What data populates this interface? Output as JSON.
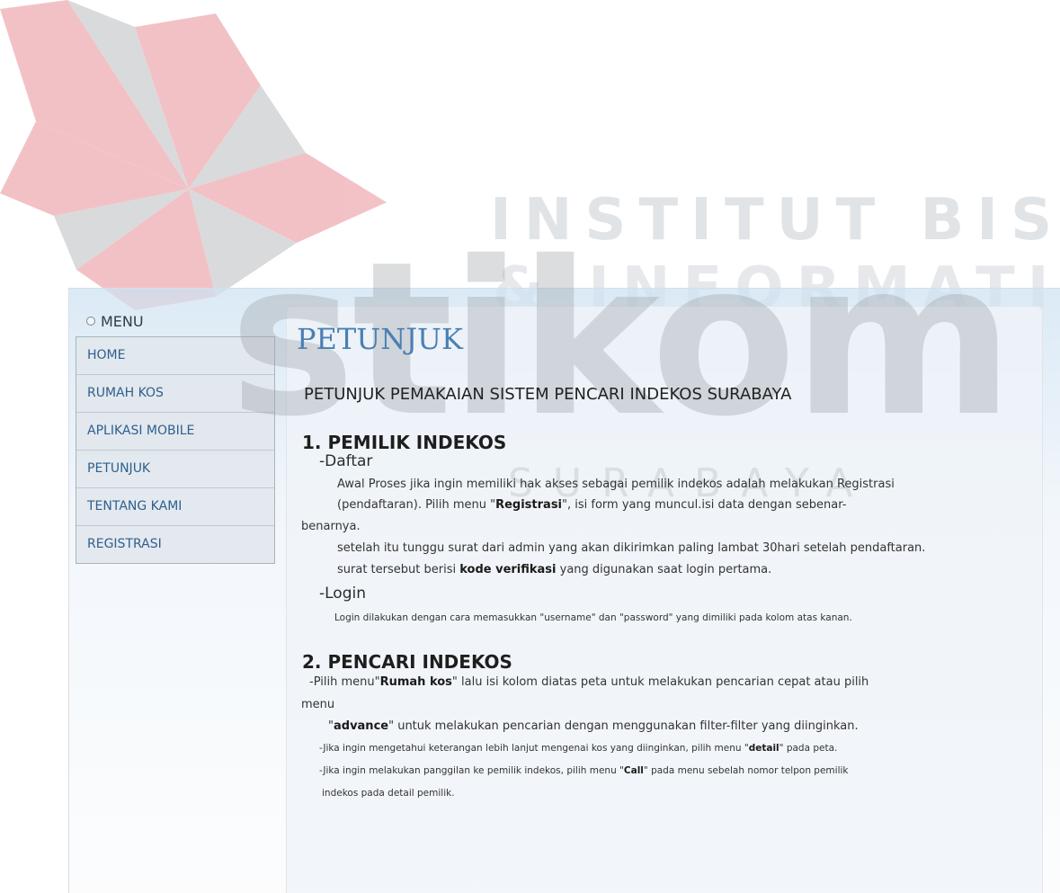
{
  "watermark": {
    "line1": "INSTITUT BISNIS",
    "line2": "& INFORMATIKA",
    "brand": "stikom",
    "line3": "SURABAYA",
    "logo_colors": [
      "#d94150",
      "#8a8f93"
    ]
  },
  "sidebar": {
    "title": "MENU",
    "items": [
      {
        "label": "HOME"
      },
      {
        "label": "RUMAH KOS"
      },
      {
        "label": "APLIKASI MOBILE"
      },
      {
        "label": "PETUNJUK"
      },
      {
        "label": "TENTANG KAMI"
      },
      {
        "label": "REGISTRASI"
      }
    ]
  },
  "main": {
    "title": "PETUNJUK",
    "subtitle": "PETUNJUK PEMAKAIAN SISTEM PENCARI INDEKOS SURABAYA",
    "section1": {
      "heading": "1. PEMILIK INDEKOS",
      "daftar_heading": "-Daftar",
      "daftar_line1": "Awal Proses jika ingin memiliki hak akses sebagai pemilik indekos adalah melakukan Registrasi",
      "daftar_line2_pre": "(pendaftaran). Pilih  menu \"",
      "daftar_line2_bold": "Registrasi",
      "daftar_line2_post": "\", isi form yang muncul.isi data dengan sebenar-",
      "daftar_line3": "benarnya.",
      "daftar_line4": "setelah itu tunggu surat dari admin yang akan dikirimkan paling lambat 30hari setelah pendaftaran.",
      "daftar_line5_pre": "surat tersebut berisi ",
      "daftar_line5_bold": "kode verifikasi",
      "daftar_line5_post": " yang digunakan saat login pertama.",
      "login_heading": "-Login",
      "login_text": "Login dilakukan dengan cara memasukkan \"username\" dan \"password\" yang dimiliki pada kolom atas kanan."
    },
    "section2": {
      "heading": "2. PENCARI INDEKOS",
      "line1_pre": "-Pilih menu\"",
      "line1_bold": "Rumah kos",
      "line1_post": "\" lalu isi kolom diatas peta untuk melakukan pencarian cepat atau pilih",
      "line2": "menu",
      "line3_pre": "\"",
      "line3_bold": "advance",
      "line3_post": "\" untuk melakukan pencarian dengan menggunakan filter-filter yang diinginkan.",
      "line4_pre": "-Jika ingin mengetahui keterangan lebih lanjut mengenai kos yang diinginkan, pilih menu \"",
      "line4_bold": "detail",
      "line4_post": "\" pada peta.",
      "line5_pre": "-Jika ingin melakukan panggilan ke pemilik indekos, pilih menu \"",
      "line5_bold": "Call",
      "line5_post": "\" pada menu sebelah nomor telpon pemilik",
      "line6": "indekos pada detail pemilik."
    }
  }
}
